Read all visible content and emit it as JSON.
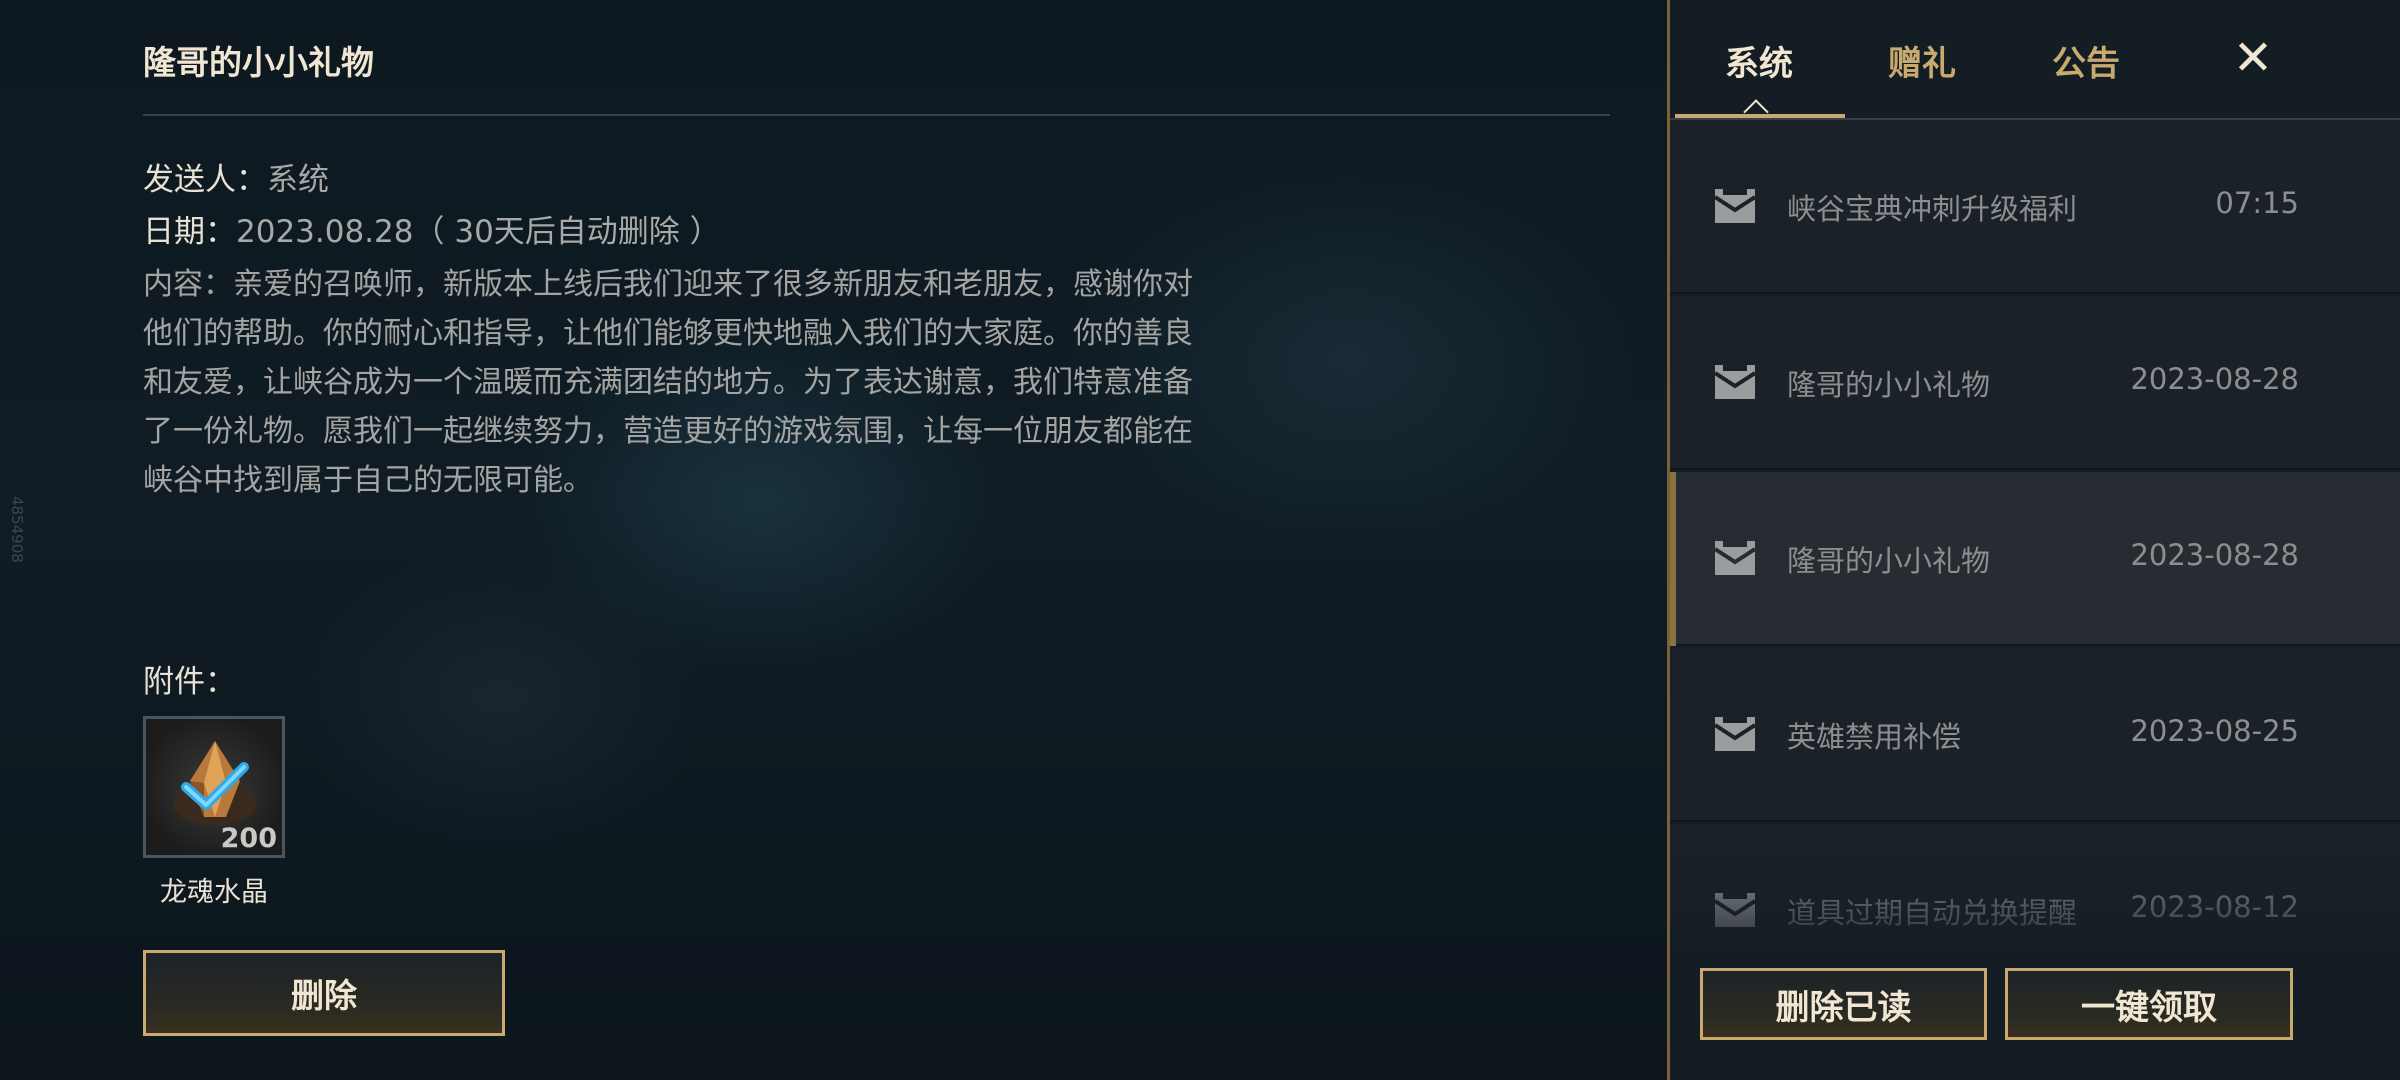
{
  "side_id": "4854908",
  "detail": {
    "title": "隆哥的小小礼物",
    "sender_label": "发送人：",
    "sender_value": "系统",
    "date_label": "日期：",
    "date_value": "2023.08.28（ 30天后自动删除 ）",
    "content": "内容：亲爱的召唤师，新版本上线后我们迎来了很多新朋友和老朋友，感谢你对他们的帮助。你的耐心和指导，让他们能够更快地融入我们的大家庭。你的善良和友爱，让峡谷成为一个温暖而充满团结的地方。为了表达谢意，我们特意准备了一份礼物。愿我们一起继续努力，营造更好的游戏氛围，让每一位朋友都能在峡谷中找到属于自己的无限可能。",
    "attachments_label": "附件：",
    "attachment": {
      "name": "龙魂水晶",
      "count": "200",
      "icon": "dragon-soul-crystal-icon"
    },
    "delete_button": "删除"
  },
  "panel": {
    "tabs": [
      {
        "label": "系统",
        "active": true
      },
      {
        "label": "赠礼",
        "active": false
      },
      {
        "label": "公告",
        "active": false
      }
    ],
    "close_icon": "close-icon",
    "mails": [
      {
        "subject": "峡谷宝典冲刺升级福利",
        "time": "07:15",
        "selected": false
      },
      {
        "subject": "隆哥的小小礼物",
        "time": "2023-08-28",
        "selected": false
      },
      {
        "subject": "隆哥的小小礼物",
        "time": "2023-08-28",
        "selected": true
      },
      {
        "subject": "英雄禁用补偿",
        "time": "2023-08-25",
        "selected": false
      },
      {
        "subject": "道具过期自动兑换提醒",
        "time": "2023-08-12",
        "selected": false
      }
    ],
    "delete_read_button": "删除已读",
    "claim_all_button": "一键领取"
  },
  "colors": {
    "gold": "#c8aa6e",
    "gold_text": "#f0e6d2",
    "panel_bg": "#151d24",
    "selected_row_bg": "#262c31"
  }
}
